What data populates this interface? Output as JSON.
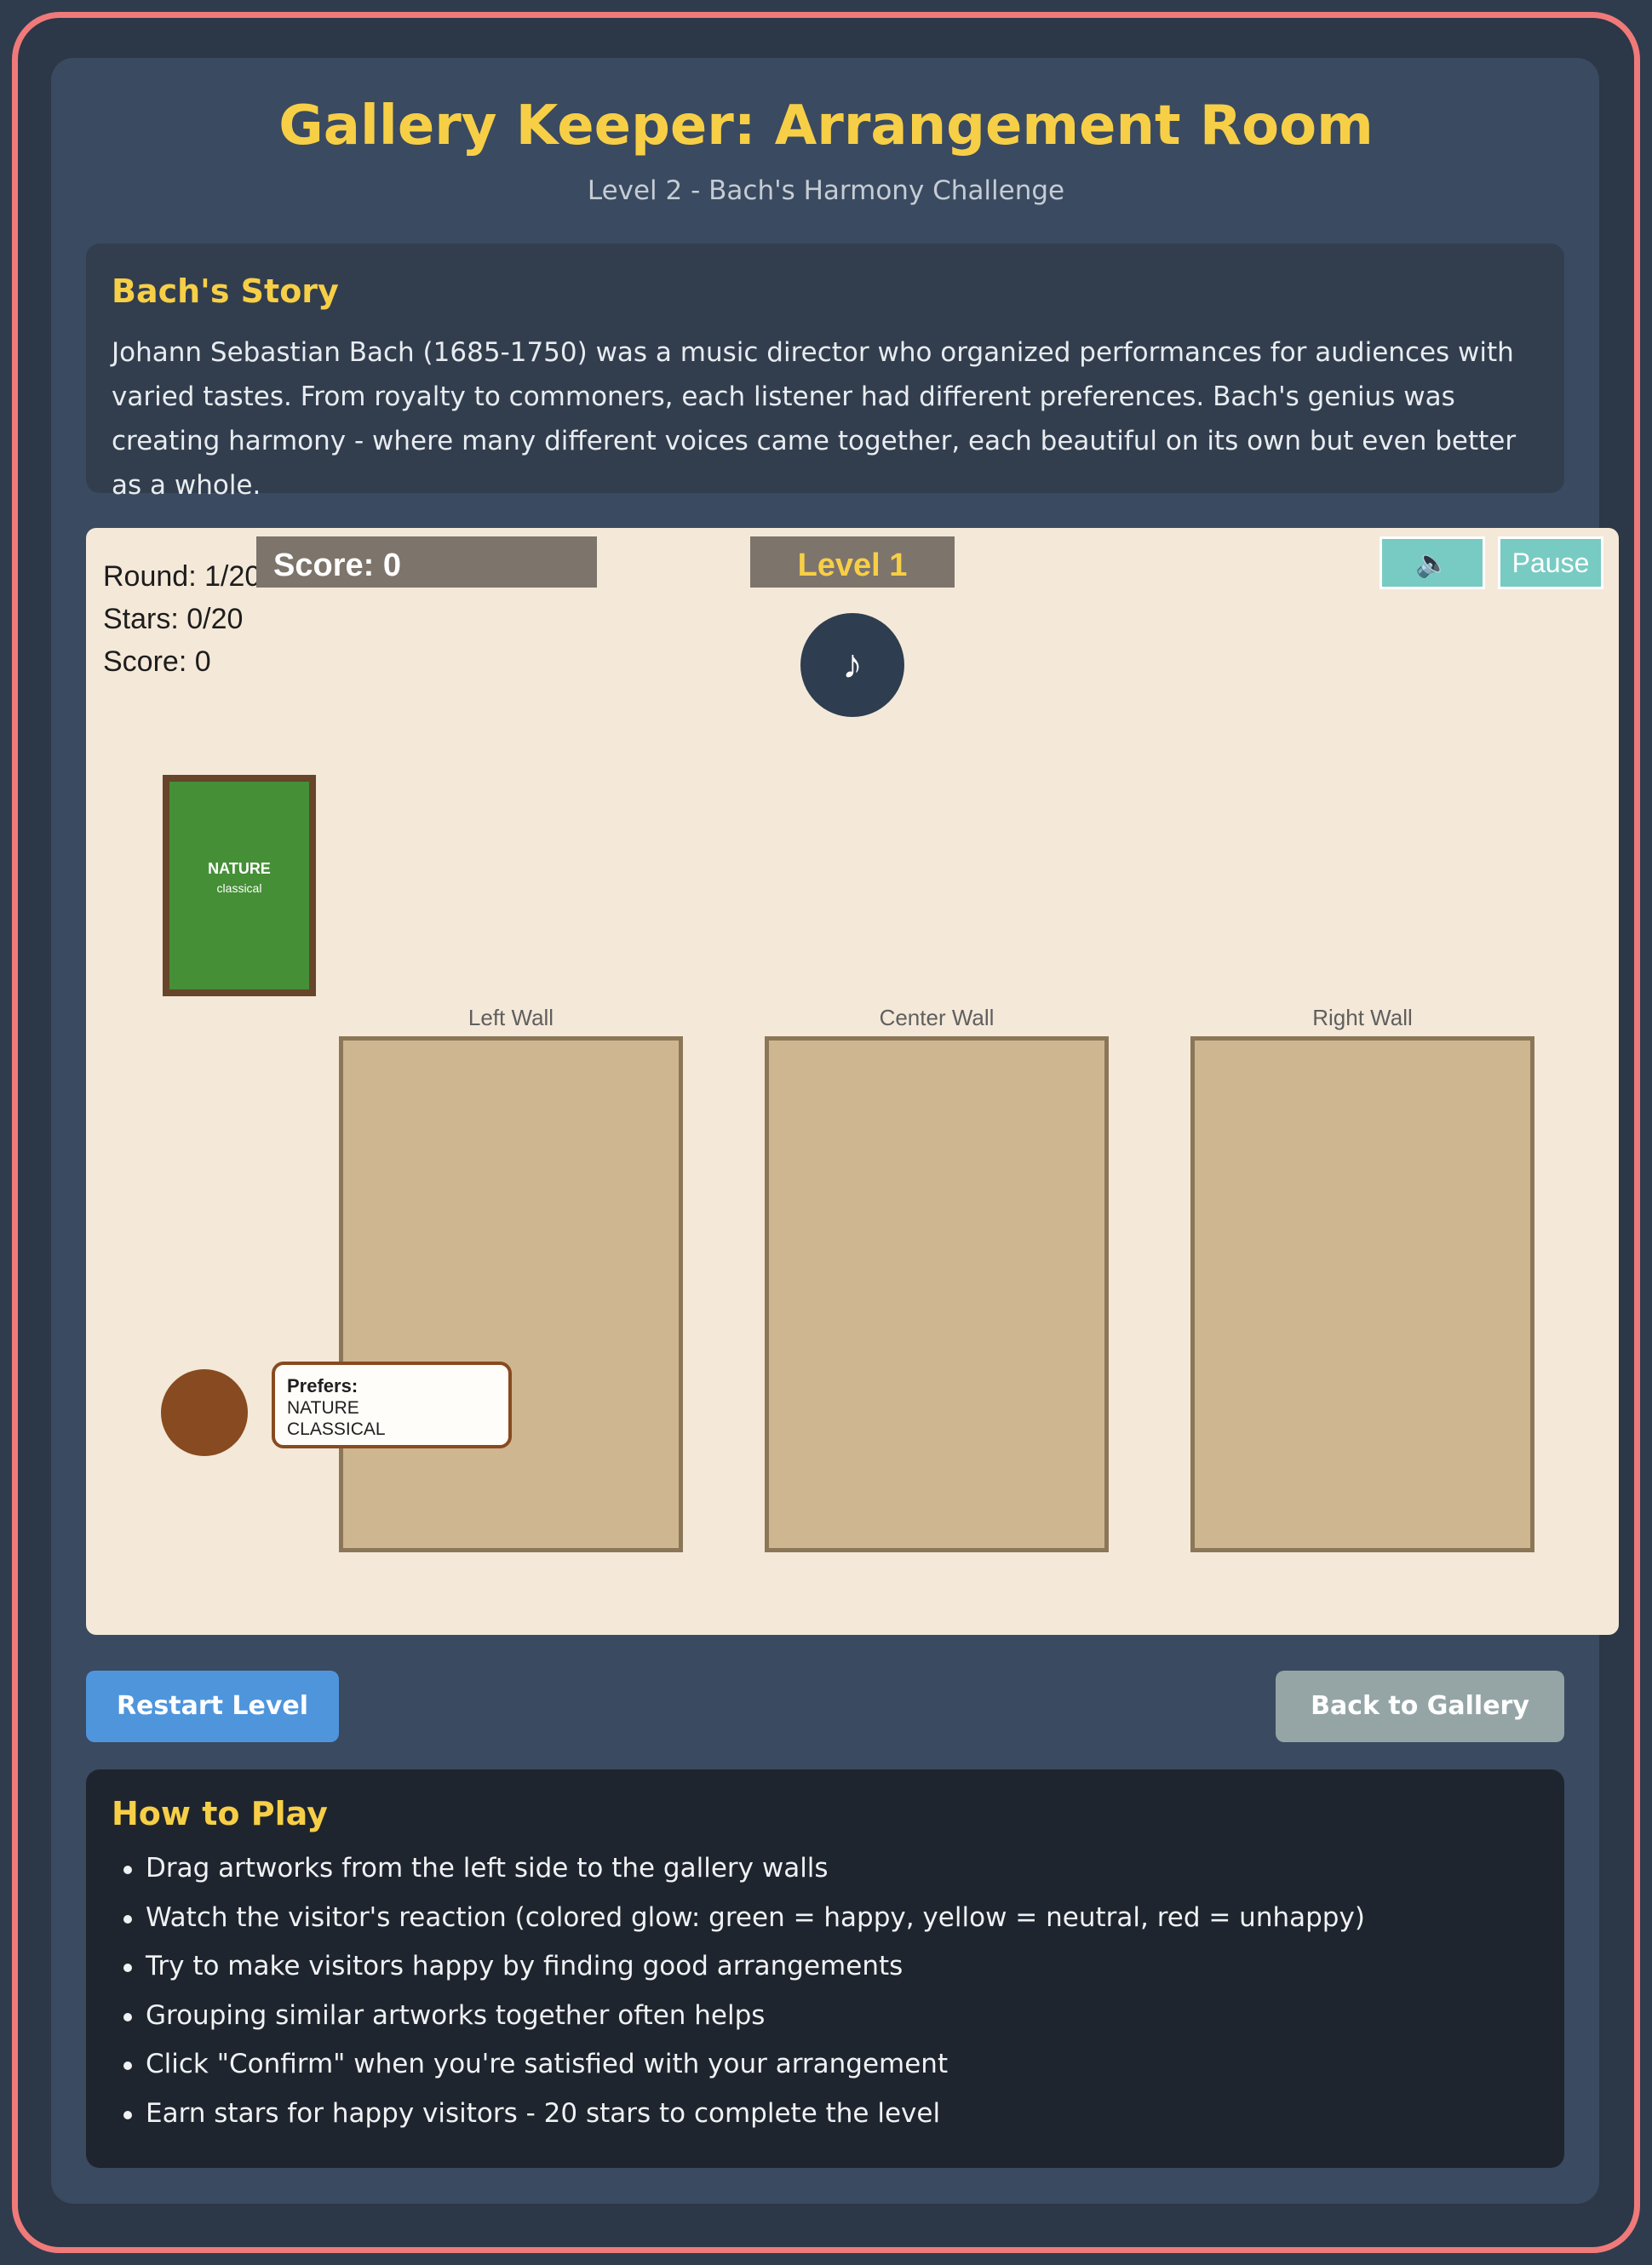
{
  "header": {
    "title": "Gallery Keeper: Arrangement Room",
    "subtitle": "Level 2 - Bach's Harmony Challenge"
  },
  "story": {
    "heading": "Bach's Story",
    "text": "Johann Sebastian Bach (1685-1750) was a music director who organized performances for audiences with varied tastes. From royalty to commoners, each listener had different preferences. Bach's genius was creating harmony - where many different voices came together, each beautiful on its own but even better as a whole."
  },
  "game": {
    "stats": {
      "round": "Round: 1/20",
      "stars": "Stars: 0/20",
      "score": "Score: 0"
    },
    "score_banner": "Score: 0",
    "level_banner": "Level 1",
    "music_icon": "♪",
    "sound_icon": "🔈",
    "pause_label": "Pause",
    "artwork": {
      "title": "NATURE",
      "style": "classical",
      "color": "#458f37",
      "frame_color": "#66452a"
    },
    "walls": [
      {
        "label": "Left Wall"
      },
      {
        "label": "Center Wall"
      },
      {
        "label": "Right Wall"
      }
    ],
    "visitor": {
      "color": "#884a20",
      "prefers_label": "Prefers:",
      "preferences": [
        "NATURE",
        "CLASSICAL"
      ]
    }
  },
  "actions": {
    "restart_label": "Restart Level",
    "back_label": "Back to Gallery"
  },
  "howto": {
    "heading": "How to Play",
    "items": [
      "Drag artworks from the left side to the gallery walls",
      "Watch the visitor's reaction (colored glow: green = happy, yellow = neutral, red = unhappy)",
      "Try to make visitors happy by finding good arrangements",
      "Grouping similar artworks together often helps",
      "Click \"Confirm\" when you're satisfied with your arrangement",
      "Earn stars for happy visitors - 20 stars to complete the level"
    ]
  },
  "colors": {
    "accent": "#f7cf47",
    "restart_button": "#4f95dc",
    "back_button": "#95a5a6",
    "frame_border": "#f07a7a"
  }
}
